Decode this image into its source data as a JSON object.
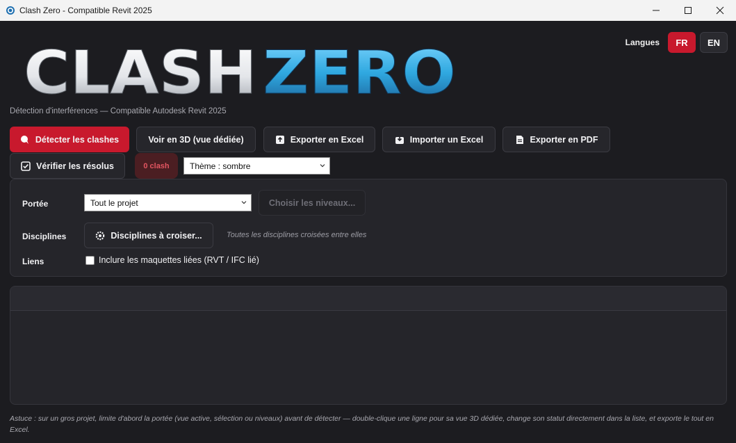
{
  "window": {
    "title": "Clash Zero - Compatible Revit 2025"
  },
  "header": {
    "language_label": "Langues",
    "languages": [
      "FR",
      "EN"
    ],
    "active_language": "FR",
    "logo_text_part1": "CLASH",
    "logo_text_part2": "ZERO",
    "subtitle": "Détection d'interférences — Compatible Autodesk Revit 2025"
  },
  "toolbar": {
    "detect_label": "Détecter les clashes",
    "view3d_label": "Voir en 3D (vue dédiée)",
    "export_excel_label": "Exporter en Excel",
    "import_excel_label": "Importer un Excel",
    "export_pdf_label": "Exporter en PDF",
    "verify_label": "Vérifier les résolus",
    "clash_count": "0 clash",
    "theme_select": "Thème : sombre"
  },
  "options": {
    "scope_label": "Portée",
    "scope_value": "Tout le projet",
    "levels_button": "Choisir les niveaux...",
    "disciplines_label": "Disciplines",
    "disciplines_button": "Disciplines à croiser...",
    "disciplines_hint": "Toutes les disciplines croisées entre elles",
    "links_label": "Liens",
    "links_checkbox_label": "Inclure les maquettes liées (RVT / IFC lié)",
    "links_checked": false
  },
  "footer": {
    "tip": "Astuce : sur un gros projet, limite d'abord la portée (vue active, sélection ou niveaux) avant de détecter — double-clique une ligne pour sa vue 3D dédiée, change son statut directement dans la liste, et exporte le tout en Excel."
  },
  "colors": {
    "accent": "#c8192d",
    "background": "#1c1c20",
    "panel": "#25252a",
    "logo_blue": "#2fa8e0"
  }
}
